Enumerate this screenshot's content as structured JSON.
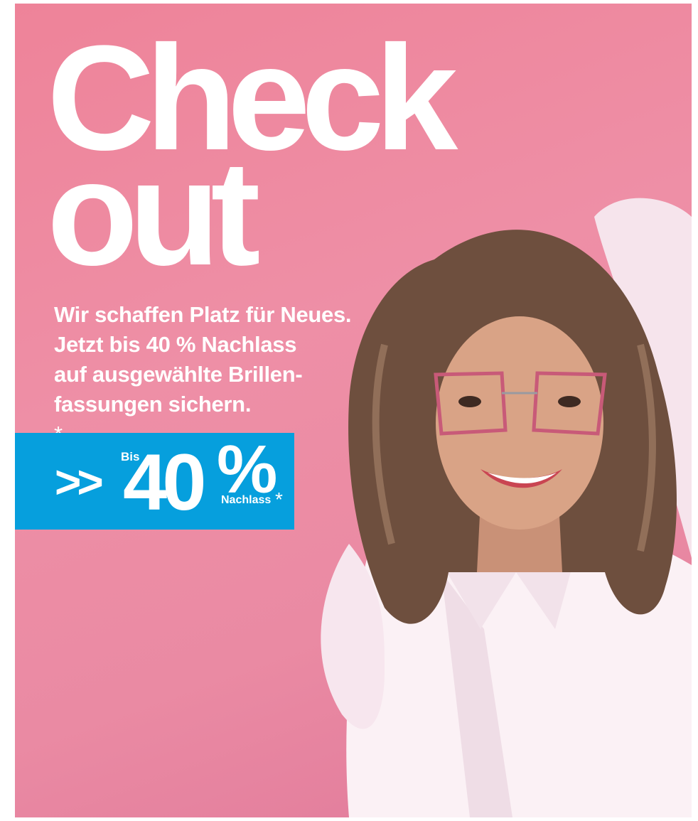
{
  "colors": {
    "background": "#ee8aa0",
    "badge": "#069fdd",
    "text": "#ffffff",
    "hair": "#6e4f3e",
    "blouse": "#fbf1f5",
    "frame": "#c85a78"
  },
  "headline": {
    "line1": "Check",
    "line2": "out"
  },
  "subtext": {
    "line1": "Wir schaffen Platz für Neues.",
    "line2": "Jetzt bis 40 % Nachlass",
    "line3": "auf ausgewählte Brillen-",
    "line4": "fassungen sichern.",
    "asterisk": "*"
  },
  "badge": {
    "arrows": ">>",
    "prefix": "Bis",
    "value": "40",
    "percent": "%",
    "suffix": "Nachlass",
    "asterisk": "*"
  }
}
